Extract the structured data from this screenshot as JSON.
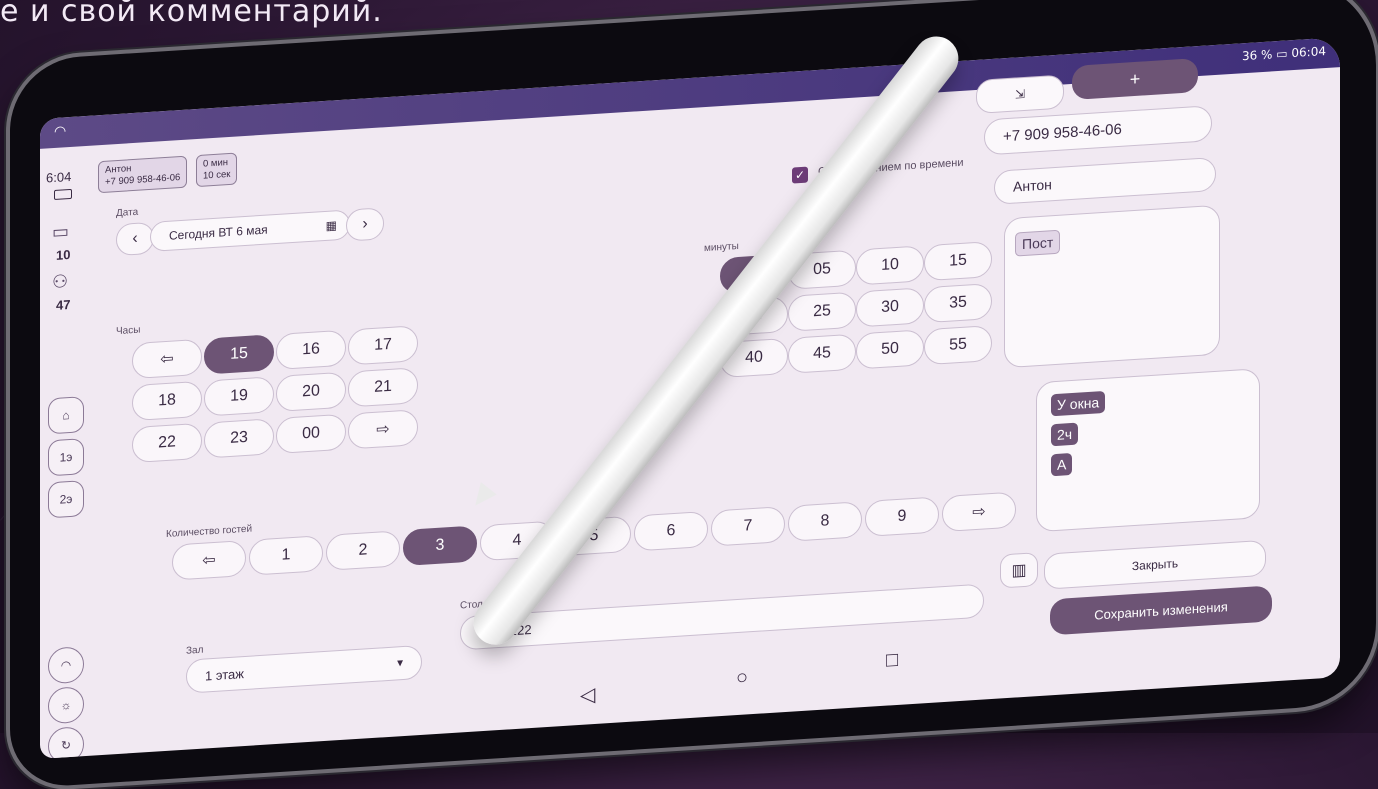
{
  "caption": "е и свой комментарий.",
  "status": {
    "battery_percent": "36 %",
    "time": "06:04"
  },
  "rail": {
    "time": "6:04",
    "count_a": "10",
    "count_b": "47",
    "hall_1": "1э",
    "hall_2": "2э"
  },
  "guest_chip": {
    "name": "Антон",
    "phone": "+7 909 958-46-06",
    "duration_min": "0 мин",
    "duration_sec": "10 сек"
  },
  "date": {
    "label": "Дата",
    "value": "Сегодня ВТ 6 мая"
  },
  "time_limit": {
    "label": "С ограничением по времени",
    "checked": true
  },
  "hours": {
    "label": "Часы",
    "values": [
      "15",
      "16",
      "17",
      "18",
      "19",
      "20",
      "21",
      "22",
      "23",
      "00"
    ],
    "selected": "15"
  },
  "minutes": {
    "label": "минуты",
    "values": [
      "00",
      "05",
      "10",
      "15",
      "20",
      "25",
      "30",
      "35",
      "40",
      "45",
      "50",
      "55"
    ],
    "selected": "00"
  },
  "guests": {
    "label": "Количество гостей",
    "values": [
      "1",
      "2",
      "3",
      "4",
      "5",
      "6",
      "7",
      "8",
      "9"
    ],
    "selected": "3"
  },
  "hall": {
    "label": "Зал",
    "value": "1 этаж"
  },
  "table": {
    "label": "Стол",
    "value": "№22"
  },
  "right": {
    "plus": "+",
    "phone": "+7 909 958-46-06",
    "name": "Антон",
    "tag_top": "Пост",
    "tags": [
      "У окна",
      "2ч",
      "А"
    ],
    "close": "Закрыть",
    "save": "Сохранить изменения"
  },
  "colors": {
    "accent": "#6d5475",
    "screen_bg": "#f1e9f2",
    "statusbar": "#4a3a82"
  }
}
